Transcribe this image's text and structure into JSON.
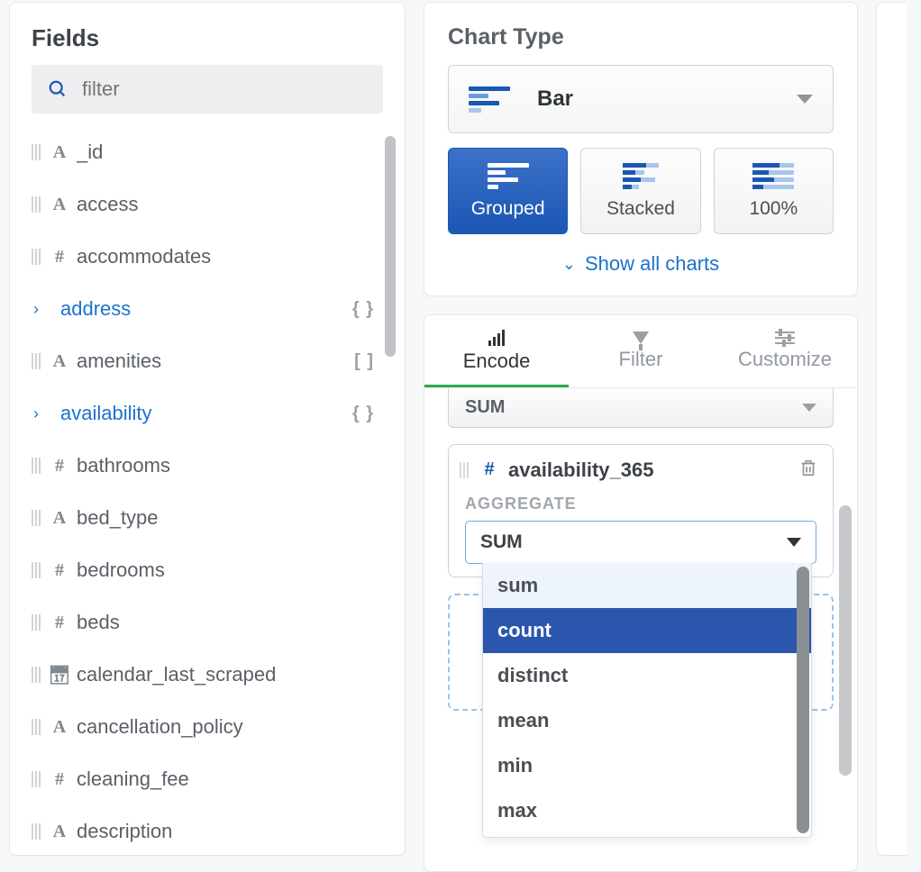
{
  "fields_panel": {
    "title": "Fields",
    "filter_placeholder": "filter",
    "items": [
      {
        "kind": "text",
        "name": "_id"
      },
      {
        "kind": "text",
        "name": "access"
      },
      {
        "kind": "number",
        "name": "accommodates"
      },
      {
        "kind": "object",
        "name": "address",
        "suffix": "braces"
      },
      {
        "kind": "text",
        "name": "amenities",
        "suffix": "brackets"
      },
      {
        "kind": "object",
        "name": "availability",
        "suffix": "braces"
      },
      {
        "kind": "number",
        "name": "bathrooms"
      },
      {
        "kind": "text",
        "name": "bed_type"
      },
      {
        "kind": "number",
        "name": "bedrooms"
      },
      {
        "kind": "number",
        "name": "beds"
      },
      {
        "kind": "date",
        "name": "calendar_last_scraped"
      },
      {
        "kind": "text",
        "name": "cancellation_policy"
      },
      {
        "kind": "number",
        "name": "cleaning_fee"
      },
      {
        "kind": "text",
        "name": "description"
      }
    ]
  },
  "chart_type": {
    "title": "Chart Type",
    "selected": "Bar",
    "subtypes": [
      "Grouped",
      "Stacked",
      "100%"
    ],
    "active_subtype": "Grouped",
    "show_all": "Show all charts"
  },
  "tabs": {
    "items": [
      "Encode",
      "Filter",
      "Customize"
    ],
    "active": "Encode"
  },
  "encode": {
    "collapsed_agg": "SUM",
    "card": {
      "field": "availability_365",
      "agg_label": "AGGREGATE",
      "agg_value": "SUM",
      "options": [
        "sum",
        "count",
        "distinct",
        "mean",
        "min",
        "max"
      ],
      "highlighted": "count",
      "hovered": "sum"
    }
  }
}
